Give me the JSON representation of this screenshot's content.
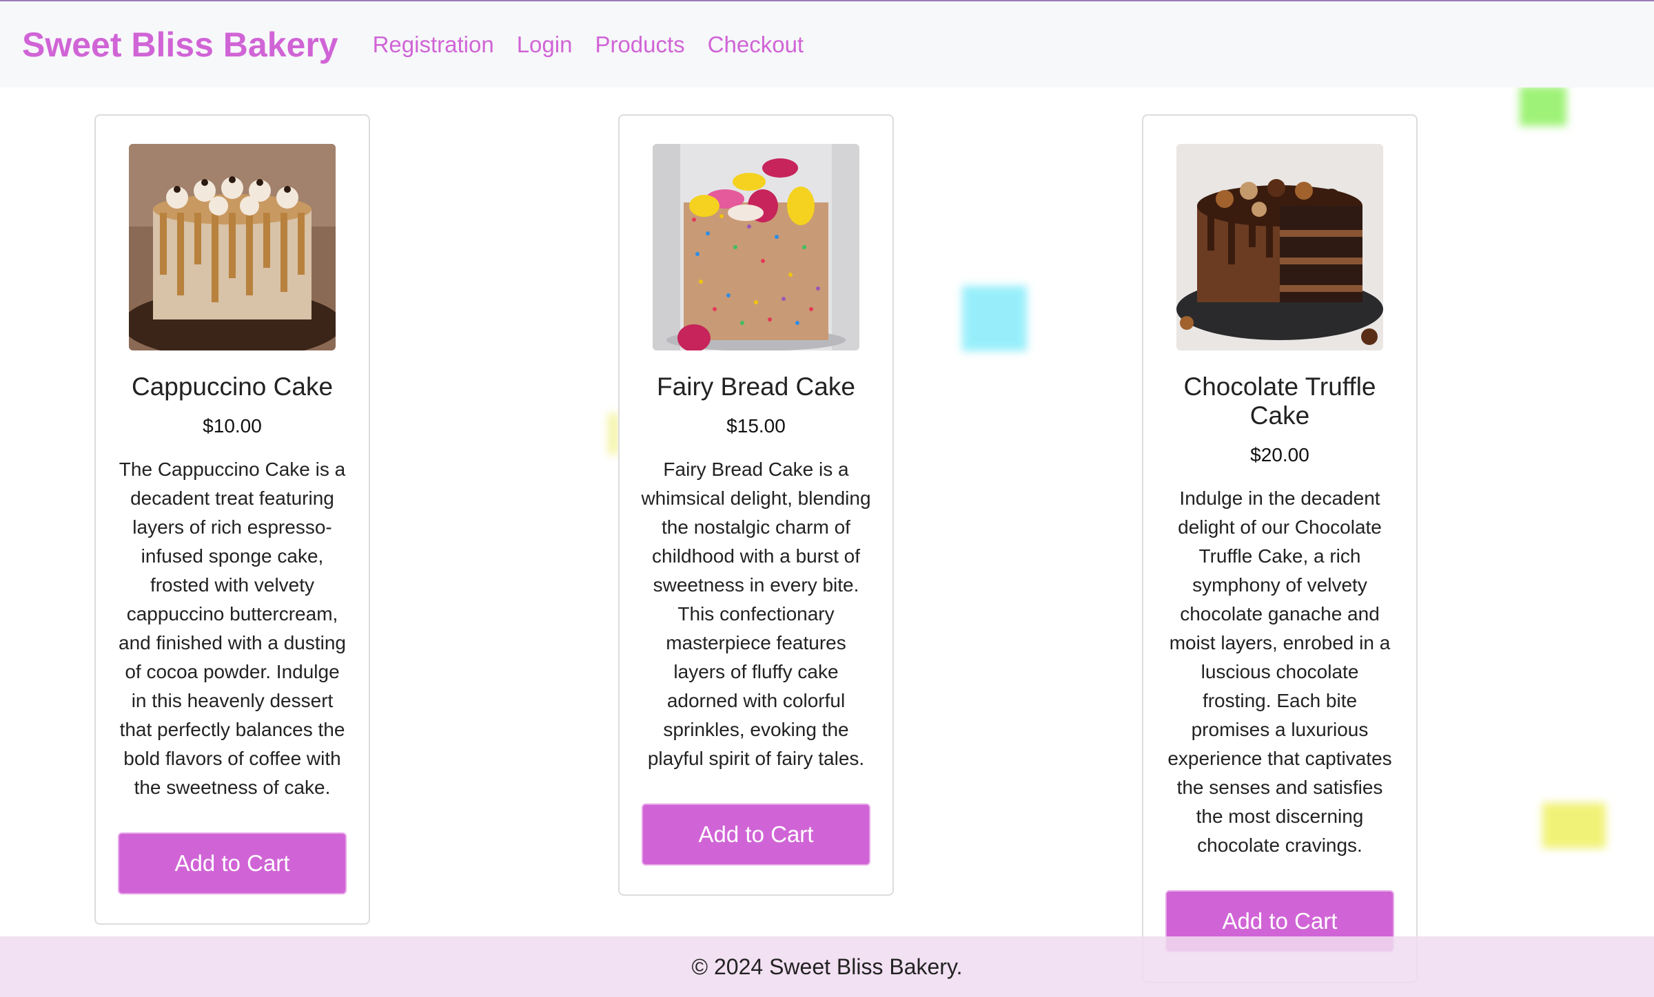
{
  "nav": {
    "brand": "Sweet Bliss Bakery",
    "links": [
      "Registration",
      "Login",
      "Products",
      "Checkout"
    ]
  },
  "colors": {
    "accent": "#d064d6",
    "topbar_bg": "#f7f8fa",
    "footer_bg": "#f2e0f2"
  },
  "products": [
    {
      "name": "Cappuccino Cake",
      "price": "$10.00",
      "description": "The Cappuccino Cake is a decadent treat featuring layers of rich espresso-infused sponge cake, frosted with velvety cappuccino buttercream, and finished with a dusting of cocoa powder. Indulge in this heavenly dessert that perfectly balances the bold flavors of coffee with the sweetness of cake.",
      "button": "Add to Cart",
      "image_icon": "cappuccino-cake-image"
    },
    {
      "name": "Fairy Bread Cake",
      "price": "$15.00",
      "description": "Fairy Bread Cake is a whimsical delight, blending the nostalgic charm of childhood with a burst of sweetness in every bite. This confectionary masterpiece features layers of fluffy cake adorned with colorful sprinkles, evoking the playful spirit of fairy tales.",
      "button": "Add to Cart",
      "image_icon": "fairy-bread-cake-image"
    },
    {
      "name": "Chocolate Truffle Cake",
      "price": "$20.00",
      "description": "Indulge in the decadent delight of our Chocolate Truffle Cake, a rich symphony of velvety chocolate ganache and moist layers, enrobed in a luscious chocolate frosting. Each bite promises a luxurious experience that captivates the senses and satisfies the most discerning chocolate cravings.",
      "button": "Add to Cart",
      "image_icon": "chocolate-truffle-cake-image"
    }
  ],
  "footer": {
    "text": "© 2024 Sweet Bliss Bakery."
  }
}
